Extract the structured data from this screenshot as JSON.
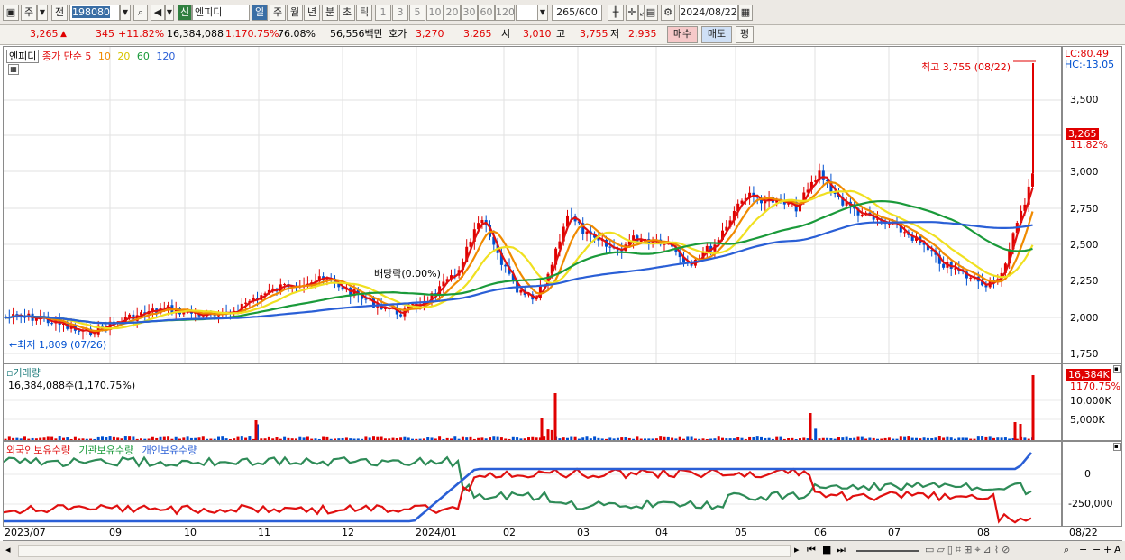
{
  "toolbar": {
    "market": "주",
    "prev": "전",
    "code": "198080",
    "badge": "신",
    "name": "엔피디",
    "periods": [
      "일",
      "주",
      "월",
      "년",
      "분",
      "초",
      "틱"
    ],
    "intervals": [
      "1",
      "3",
      "5",
      "10",
      "20",
      "30",
      "60",
      "120"
    ],
    "count_current": "265",
    "count_total": "/600",
    "date": "2024/08/22"
  },
  "quote": {
    "price": "3,265",
    "change": "345",
    "pct": "+11.82%",
    "volume": "16,384,088",
    "vol_pct": "1,170.75%",
    "ratio": "76.08%",
    "amount": "56,556백만",
    "ask_label": "호가",
    "ask1": "3,270",
    "ask2": "3,265",
    "open_label": "시",
    "open": "3,010",
    "high_label": "고",
    "high": "3,755",
    "low_label": "저",
    "low": "2,935",
    "buy": "매수",
    "sell": "매도",
    "eval": "평"
  },
  "price_pane": {
    "title": "엔피디",
    "ma_label": "종가 단순",
    "ma": [
      {
        "period": "5",
        "color": "#e01010"
      },
      {
        "period": "10",
        "color": "#f08a00"
      },
      {
        "period": "20",
        "color": "#f0e020"
      },
      {
        "period": "60",
        "color": "#1a9a3a"
      },
      {
        "period": "120",
        "color": "#2a5fd6"
      }
    ],
    "high_annot": "최고 3,755 (08/22)",
    "low_annot": "최저 1,809 (07/26)",
    "dividend_annot": "배당락(0.00%)",
    "lc": "LC:80.49",
    "hc": "HC:-13.05",
    "yticks": [
      "3,500",
      "3,250",
      "3,000",
      "2,750",
      "2,500",
      "2,250",
      "2,000",
      "1,750"
    ],
    "last_price": "3,265",
    "last_pct": "11.82%"
  },
  "volume_pane": {
    "title": "거래량",
    "value": "16,384,088주(1,170.75%)",
    "yticks": [
      "10,000K",
      "5,000K"
    ],
    "last": "16,384K",
    "last_pct": "1170.75%"
  },
  "holdings_pane": {
    "legend": [
      {
        "label": "외국인보유수량",
        "color": "#e01010"
      },
      {
        "label": "기관보유수량",
        "color": "#1a9a3a"
      },
      {
        "label": "개인보유수량",
        "color": "#2a5fd6"
      }
    ],
    "yticks": [
      "0",
      "-250,000"
    ]
  },
  "xaxis": [
    "2023/07",
    "09",
    "10",
    "11",
    "12",
    "2024/01",
    "02",
    "03",
    "04",
    "05",
    "06",
    "07",
    "08"
  ],
  "xaxis_end": "08/22",
  "colors": {
    "up": "#e00000",
    "down": "#0050d0",
    "toolbar_bg": "#ece9e4"
  }
}
